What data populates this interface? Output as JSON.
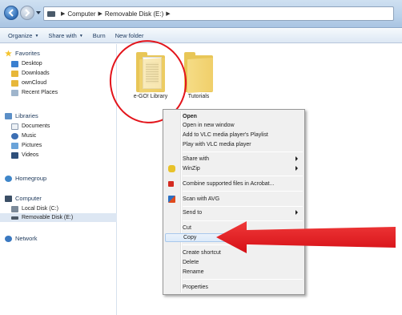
{
  "addressbar": {
    "breadcrumb": [
      "Computer",
      "Removable Disk (E:)"
    ]
  },
  "toolbar": {
    "organize": "Organize",
    "share_with": "Share with",
    "burn": "Burn",
    "new_folder": "New folder"
  },
  "sidebar": {
    "favorites": "Favorites",
    "desktop": "Desktop",
    "downloads": "Downloads",
    "owncloud": "ownCloud",
    "recent_places": "Recent Places",
    "libraries": "Libraries",
    "documents": "Documents",
    "music": "Music",
    "pictures": "Pictures",
    "videos": "Videos",
    "homegroup": "Homegroup",
    "computer": "Computer",
    "local_disk": "Local Disk (C:)",
    "removable_disk": "Removable Disk (E:)",
    "network": "Network"
  },
  "content": {
    "folders": [
      "e-GO! Library",
      "Tutorials"
    ]
  },
  "context_menu": {
    "open": "Open",
    "open_new_window": "Open in new window",
    "add_vlc_playlist": "Add to VLC media player's Playlist",
    "play_vlc": "Play with VLC media player",
    "share_with": "Share with",
    "winzip": "WinZip",
    "combine_acrobat": "Combine supported files in Acrobat...",
    "scan_avg": "Scan with AVG",
    "send_to": "Send to",
    "cut": "Cut",
    "copy": "Copy",
    "create_shortcut": "Create shortcut",
    "delete": "Delete",
    "rename": "Rename",
    "properties": "Properties"
  },
  "colors": {
    "annotation": "#e3141b",
    "folder": "#e8c657",
    "hover": "#dceaf9"
  }
}
